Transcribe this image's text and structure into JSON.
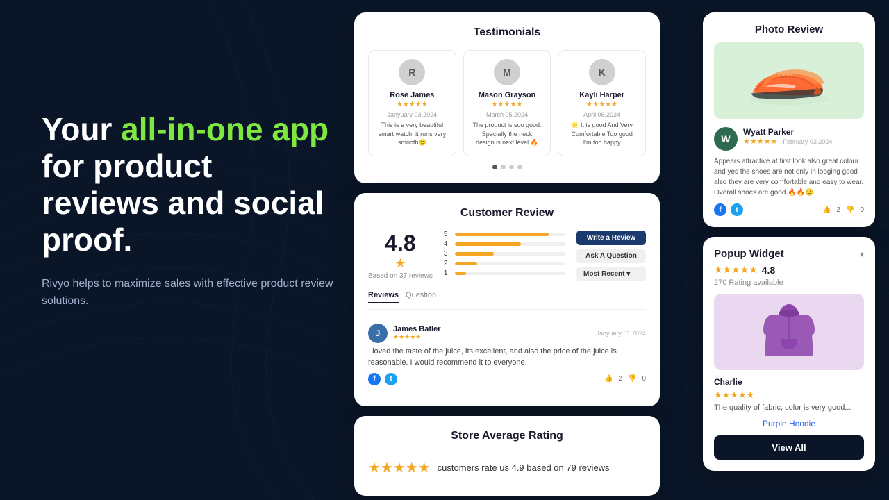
{
  "background": {
    "color": "#0a1628"
  },
  "hero": {
    "headline_start": "Your ",
    "headline_highlight": "all-in-one app",
    "headline_end": " for product reviews and social proof.",
    "subtext": "Rivyo helps to maximize sales with effective product review solutions."
  },
  "testimonials_widget": {
    "title": "Testimonials",
    "reviewers": [
      {
        "initial": "R",
        "name": "Rose James",
        "date": "Janyuary 03,2024",
        "stars": "★★★★★",
        "text": "This is a very beautiful smart watch, it runs very smooth🙂"
      },
      {
        "initial": "M",
        "name": "Mason Grayson",
        "date": "March 05,2024",
        "stars": "★★★★★",
        "text": "The product is soo good. Specially the neck design is next level 🔥"
      },
      {
        "initial": "K",
        "name": "Kayli Harper",
        "date": "April 06,2024",
        "stars": "★★★★★",
        "text": "🌟 It is good And Very Comfortable Too good I'm too happy"
      }
    ],
    "dots": [
      true,
      false,
      false,
      false
    ]
  },
  "customer_review_widget": {
    "title": "Customer Review",
    "rating": "4.8",
    "rating_star": "★",
    "based_on": "Based on 37 reviews",
    "bars": [
      {
        "label": "5",
        "fill": 85
      },
      {
        "label": "4",
        "fill": 60
      },
      {
        "label": "3",
        "fill": 35
      },
      {
        "label": "2",
        "fill": 20
      },
      {
        "label": "1",
        "fill": 10
      }
    ],
    "buttons": {
      "write": "Write a Review",
      "ask": "Ask A Question",
      "recent": "Most Recent ▾"
    },
    "tabs": [
      "Reviews",
      "Question"
    ],
    "active_tab": "Reviews",
    "review": {
      "initial": "J",
      "name": "James Batler",
      "date": "Janyuary 01,2024",
      "stars": "★★★★★",
      "text": "I loved the taste of the juice, its excellent, and also the price of the juice is reasonable. I would recommend it to everyone.",
      "likes": "2",
      "dislikes": "0"
    }
  },
  "store_average_rating": {
    "title": "Store Average Rating",
    "stars": "★★★★★",
    "text": "customers rate us 4.9 based on 79 reviews"
  },
  "photo_review": {
    "title": "Photo Review",
    "reviewer": {
      "initial": "W",
      "name": "Wyatt Parker",
      "stars": "★★★★★",
      "date": "February 03,2024",
      "text": "Appears attractive at first look also great colour and yes the shoes are not only in looging good also they are very comfortable and easy to wear. Overall shoes are good.🔥🔥🙂"
    },
    "likes": "2",
    "dislikes": "0"
  },
  "popup_widget": {
    "title": "Popup Widget",
    "rating": "4.8",
    "stars": "★★★★★",
    "rating_count": "270 Rating available",
    "product": {
      "name": "Charlie",
      "stars": "★★★★★",
      "review_text": "The quality of fabric, color is very good...",
      "link": "Purple Hoodie"
    },
    "view_all_label": "View All"
  }
}
